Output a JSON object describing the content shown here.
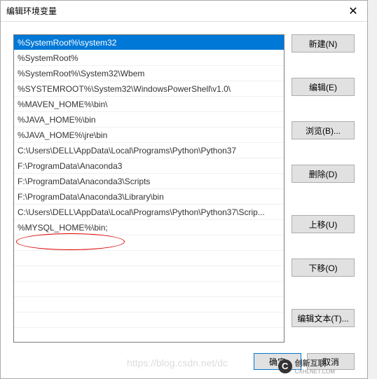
{
  "title": "编辑环境变量",
  "close_glyph": "✕",
  "list_items": [
    "%SystemRoot%\\system32",
    "%SystemRoot%",
    "%SystemRoot%\\System32\\Wbem",
    "%SYSTEMROOT%\\System32\\WindowsPowerShell\\v1.0\\",
    "%MAVEN_HOME%\\bin\\",
    "%JAVA_HOME%\\bin",
    "%JAVA_HOME%\\jre\\bin",
    "C:\\Users\\DELL\\AppData\\Local\\Programs\\Python\\Python37",
    "F:\\ProgramData\\Anaconda3",
    "F:\\ProgramData\\Anaconda3\\Scripts",
    "F:\\ProgramData\\Anaconda3\\Library\\bin",
    "C:\\Users\\DELL\\AppData\\Local\\Programs\\Python\\Python37\\Scrip...",
    "%MYSQL_HOME%\\bin;"
  ],
  "selected_index": 0,
  "buttons": {
    "new": "新建(N)",
    "edit": "编辑(E)",
    "browse": "浏览(B)...",
    "delete": "删除(D)",
    "moveup": "上移(U)",
    "movedown": "下移(O)",
    "edittext": "编辑文本(T)..."
  },
  "bottom": {
    "ok": "确定",
    "cancel": "取消"
  },
  "watermark": {
    "brand": "创新互联",
    "sub": "CXHLNET.COM",
    "faint": "https://blog.csdn.net/dc"
  }
}
